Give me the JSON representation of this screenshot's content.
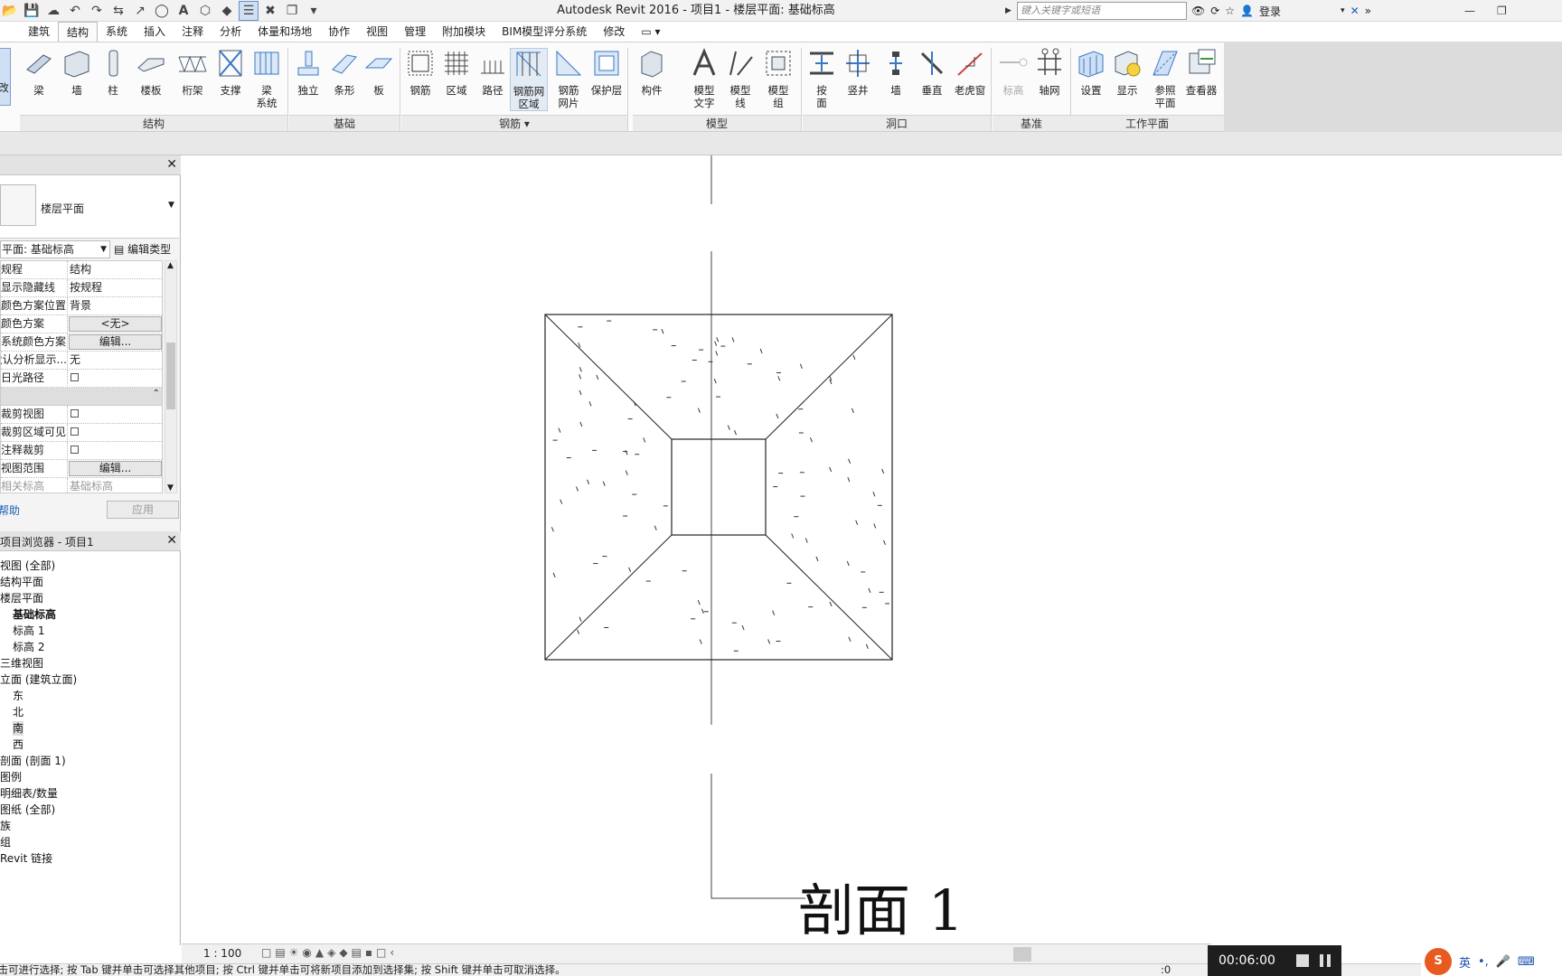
{
  "titlebar": {
    "title": "Autodesk Revit 2016 -     项目1 - 楼层平面: 基础标高",
    "search_placeholder": "键入关键字或短语",
    "login": "登录"
  },
  "tabs": [
    {
      "label": "建筑"
    },
    {
      "label": "结构"
    },
    {
      "label": "系统"
    },
    {
      "label": "插入"
    },
    {
      "label": "注释"
    },
    {
      "label": "分析"
    },
    {
      "label": "体量和场地"
    },
    {
      "label": "协作"
    },
    {
      "label": "视图"
    },
    {
      "label": "管理"
    },
    {
      "label": "附加模块"
    },
    {
      "label": "BIM模型评分系统"
    },
    {
      "label": "修改"
    }
  ],
  "ribbon": {
    "modify": "改",
    "buttons": {
      "beam": "梁",
      "wall": "墙",
      "column": "柱",
      "floor": "楼板",
      "truss": "桁架",
      "brace": "支撑",
      "beam_system": "梁\n系统",
      "isolated": "独立",
      "strip": "条形",
      "slab": "板",
      "rebar": "钢筋",
      "area": "区域",
      "path": "路径",
      "fabric_area": "钢筋网\n区域",
      "fabric_sheet": "钢筋\n网片",
      "cover": "保护层",
      "component": "构件",
      "model_text": "模型\n文字",
      "model_line": "模型\n线",
      "model_group": "模型\n组",
      "by_face": "按\n面",
      "shaft": "竖井",
      "opening_wall": "墙",
      "vertical": "垂直",
      "dormer": "老虎窗",
      "level": "标高",
      "grid": "轴网",
      "set": "设置",
      "show": "显示",
      "ref_plane": "参照\n平面",
      "viewer": "查看器"
    },
    "panels": {
      "structure": "结构",
      "foundation": "基础",
      "reinforcement": "钢筋 ▾",
      "model": "模型",
      "opening": "洞口",
      "datum": "基准",
      "workplane": "工作平面"
    }
  },
  "properties": {
    "type_name": "楼层平面",
    "filter": "平面: 基础标高",
    "edit_type": "编辑类型",
    "rows": [
      {
        "label": "规程",
        "value": "结构"
      },
      {
        "label": "显示隐藏线",
        "value": "按规程"
      },
      {
        "label": "颜色方案位置",
        "value": "背景"
      },
      {
        "label": "颜色方案",
        "button": "<无>"
      },
      {
        "label": "系统颜色方案",
        "button": "编辑..."
      },
      {
        "label": "默认分析显示...",
        "value": "无"
      },
      {
        "label": "日光路径",
        "value": ""
      },
      {
        "label": "裁剪视图",
        "value": ""
      },
      {
        "label": "裁剪区域可见",
        "value": ""
      },
      {
        "label": "注释裁剪",
        "value": ""
      },
      {
        "label": "视图范围",
        "button": "编辑..."
      },
      {
        "label": "相关标高",
        "value": "基础标高"
      }
    ],
    "help": "属性帮助",
    "apply": "应用"
  },
  "browser": {
    "title": "项目浏览器 - 项目1",
    "items": [
      {
        "text": "视图 (全部)"
      },
      {
        "text": "结构平面"
      },
      {
        "text": "楼层平面"
      },
      {
        "text": "基础标高"
      },
      {
        "text": "标高 1"
      },
      {
        "text": "标高 2"
      },
      {
        "text": "三维视图"
      },
      {
        "text": "立面 (建筑立面)"
      },
      {
        "text": "东"
      },
      {
        "text": "北"
      },
      {
        "text": "南"
      },
      {
        "text": "西"
      },
      {
        "text": "剖面 (剖面 1)"
      },
      {
        "text": "图例"
      },
      {
        "text": "明细表/数量"
      },
      {
        "text": "图纸 (全部)"
      },
      {
        "text": "族"
      },
      {
        "text": "组"
      },
      {
        "text": "Revit 链接"
      }
    ]
  },
  "canvas": {
    "section_label": "剖面  1"
  },
  "viewbar": {
    "scale": "1 : 100"
  },
  "status": {
    "text": "单击可进行选择; 按 Tab 键并单击可选择其他项目; 按 Ctrl 键并单击可将新项目添加到选择集; 按 Shift 键并单击可取消选择。",
    "filter_count": ":0"
  },
  "recorder": {
    "time": "00:06:00"
  },
  "ime": {
    "lang": "英"
  }
}
